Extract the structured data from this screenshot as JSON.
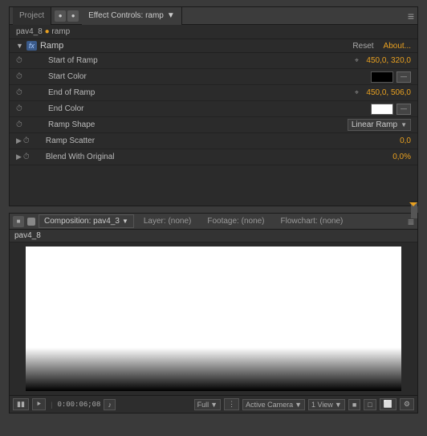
{
  "topPanel": {
    "tabs": [
      {
        "label": "Project",
        "active": false
      },
      {
        "label": "Effect Controls: ramp",
        "active": true
      }
    ],
    "breadcrumb": {
      "text": "pav4_8",
      "separator": "•",
      "subtext": "ramp"
    },
    "effect": {
      "fxBadge": "fx",
      "name": "Ramp",
      "resetLabel": "Reset",
      "aboutLabel": "About...",
      "properties": [
        {
          "id": "start-of-ramp",
          "label": "Start of Ramp",
          "type": "coordinate",
          "value": "450,0, 320,0",
          "hasStopwatch": true
        },
        {
          "id": "start-color",
          "label": "Start Color",
          "type": "color",
          "colorType": "black",
          "hasStopwatch": true
        },
        {
          "id": "end-of-ramp",
          "label": "End of Ramp",
          "type": "coordinate",
          "value": "450,0, 506,0",
          "hasStopwatch": true
        },
        {
          "id": "end-color",
          "label": "End Color",
          "type": "color",
          "colorType": "white",
          "hasStopwatch": true
        },
        {
          "id": "ramp-shape",
          "label": "Ramp Shape",
          "type": "dropdown",
          "value": "Linear Ramp",
          "hasStopwatch": true
        },
        {
          "id": "ramp-scatter",
          "label": "Ramp Scatter",
          "type": "group",
          "value": "0,0",
          "hasStopwatch": true
        },
        {
          "id": "blend-with-original",
          "label": "Blend With Original",
          "type": "group",
          "value": "0,0%",
          "hasStopwatch": true
        }
      ]
    }
  },
  "bottomPanel": {
    "tabs": [
      {
        "label": "Composition: pav4_3",
        "active": true
      },
      {
        "label": "Layer: (none)",
        "active": false
      },
      {
        "label": "Footage: (none)",
        "active": false
      },
      {
        "label": "Flowchart: (none)",
        "active": false
      }
    ],
    "compName": "pav4_8",
    "footer": {
      "timecode": "0:00:06;08",
      "zoomLabel": "Full",
      "cameraLabel": "Active Camera",
      "viewLabel": "1 View"
    }
  }
}
